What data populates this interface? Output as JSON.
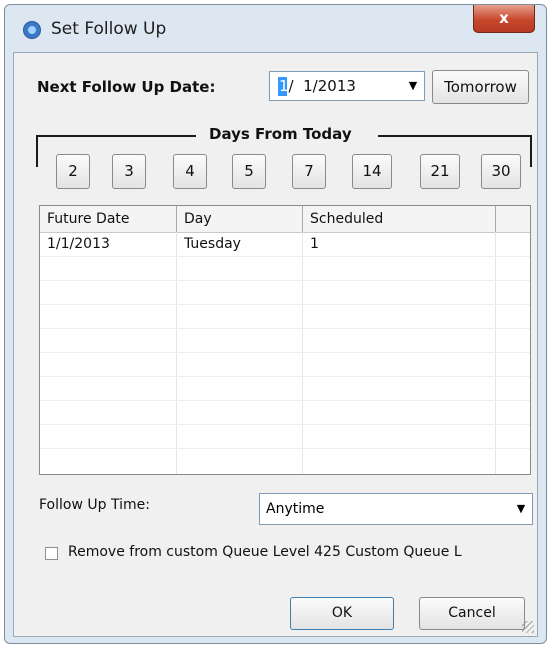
{
  "window": {
    "title": "Set Follow Up",
    "close_symbol": "x"
  },
  "next_follow_up": {
    "label": "Next Follow Up Date:",
    "date_highlight": "1",
    "date_rest": "/  1/2013",
    "tomorrow_label": "Tomorrow"
  },
  "days_from_today": {
    "label": "Days From Today",
    "buttons": [
      "2",
      "3",
      "4",
      "5",
      "7",
      "14",
      "21",
      "30"
    ]
  },
  "grid": {
    "columns": [
      "Future Date",
      "Day",
      "Scheduled"
    ],
    "rows": [
      {
        "future_date": "1/1/2013",
        "day": "Tuesday",
        "scheduled": "1"
      }
    ]
  },
  "follow_up_time": {
    "label": "Follow Up Time:",
    "value": "Anytime"
  },
  "remove_queue": {
    "label": "Remove from custom Queue Level 425 Custom Queue L",
    "checked": false
  },
  "buttons": {
    "ok": "OK",
    "cancel": "Cancel"
  },
  "colors": {
    "close": "#c7472b",
    "frame": "#dce7f1",
    "selection": "#3399ff"
  }
}
